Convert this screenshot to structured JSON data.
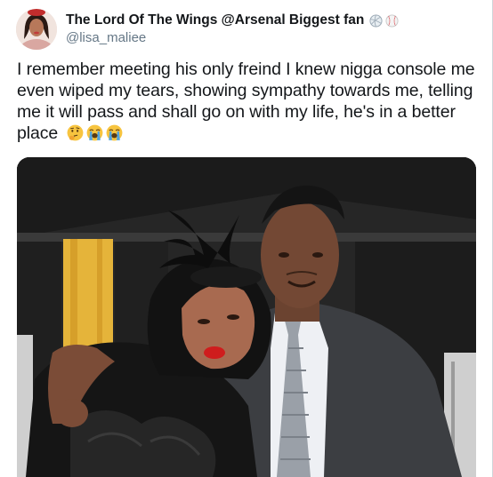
{
  "tweet": {
    "display_name": "The Lord Of The Wings @Arsenal Biggest fan",
    "name_emojis": [
      "volleyball-icon",
      "baseball-icon"
    ],
    "handle": "@lisa_maliee",
    "text": "I remember meeting his only freind I knew nigga console me even wiped my tears, showing sympathy towards me, telling me it will pass and shall go on with my life, he's in a better place",
    "text_emojis": [
      "thinking-face-icon",
      "loudly-crying-face-icon",
      "loudly-crying-face-icon"
    ]
  },
  "colors": {
    "text": "#14171a",
    "handle": "#657786",
    "background": "#ffffff"
  }
}
